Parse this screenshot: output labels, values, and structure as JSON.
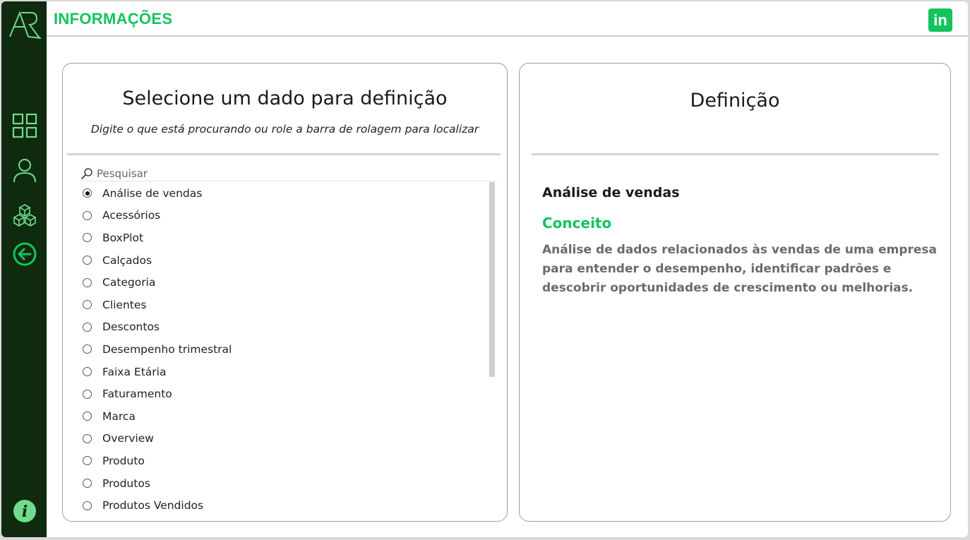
{
  "header": {
    "title": "INFORMAÇÕES",
    "linkedin_label": "in",
    "accent_color": "#14c45c"
  },
  "sidebar": {
    "logo_icon": "ar-logo-icon",
    "items": [
      {
        "icon": "grid-icon"
      },
      {
        "icon": "user-icon"
      },
      {
        "icon": "cubes-icon"
      },
      {
        "icon": "back-arrow-icon"
      }
    ],
    "info_label": "i",
    "background_color": "#0f2a0e"
  },
  "selector": {
    "title": "Selecione um dado para definição",
    "subtitle": "Digite o que está procurando ou role a barra de rolagem para localizar",
    "search_placeholder": "Pesquisar",
    "selected_index": 0,
    "items": [
      "Análise de vendas",
      "Acessórios",
      "BoxPlot",
      "Calçados",
      "Categoria",
      "Clientes",
      "Descontos",
      "Desempenho trimestral",
      "Faixa Etária",
      "Faturamento",
      "Marca",
      "Overview",
      "Produto",
      "Produtos",
      "Produtos Vendidos"
    ]
  },
  "definition": {
    "title": "Definição",
    "term": "Análise de vendas",
    "concept_label": "Conceito",
    "text": "Análise de dados relacionados às vendas de uma empresa para entender o desempenho, identificar padrões e descobrir oportunidades de crescimento ou melhorias."
  }
}
